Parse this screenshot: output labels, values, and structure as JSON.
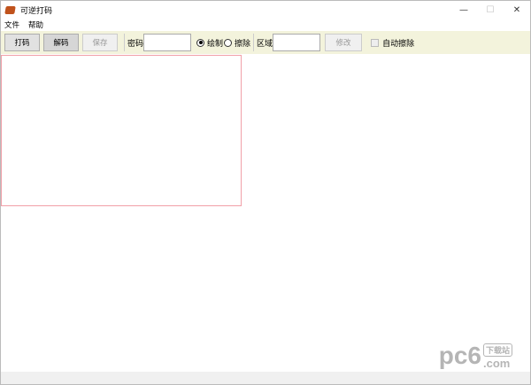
{
  "window": {
    "title": "可逆打码",
    "controls": [
      "—",
      "☐",
      "✕"
    ]
  },
  "menu": [
    "文件",
    "帮助"
  ],
  "toolbar": {
    "encode_label": "打码",
    "decode_label": "解码",
    "save_label": "保存",
    "password_label": "密码",
    "password_value": "",
    "draw_label": "绘制",
    "erase_label": "擦除",
    "mode_selected": "绘制",
    "region_label": "区域",
    "region_value": "",
    "modify_label": "修改",
    "auto_erase_label": "自动擦除",
    "auto_erase_checked": false
  },
  "watermark": {
    "brand": "pc6",
    "site": "下载站",
    "tld": ".com"
  }
}
